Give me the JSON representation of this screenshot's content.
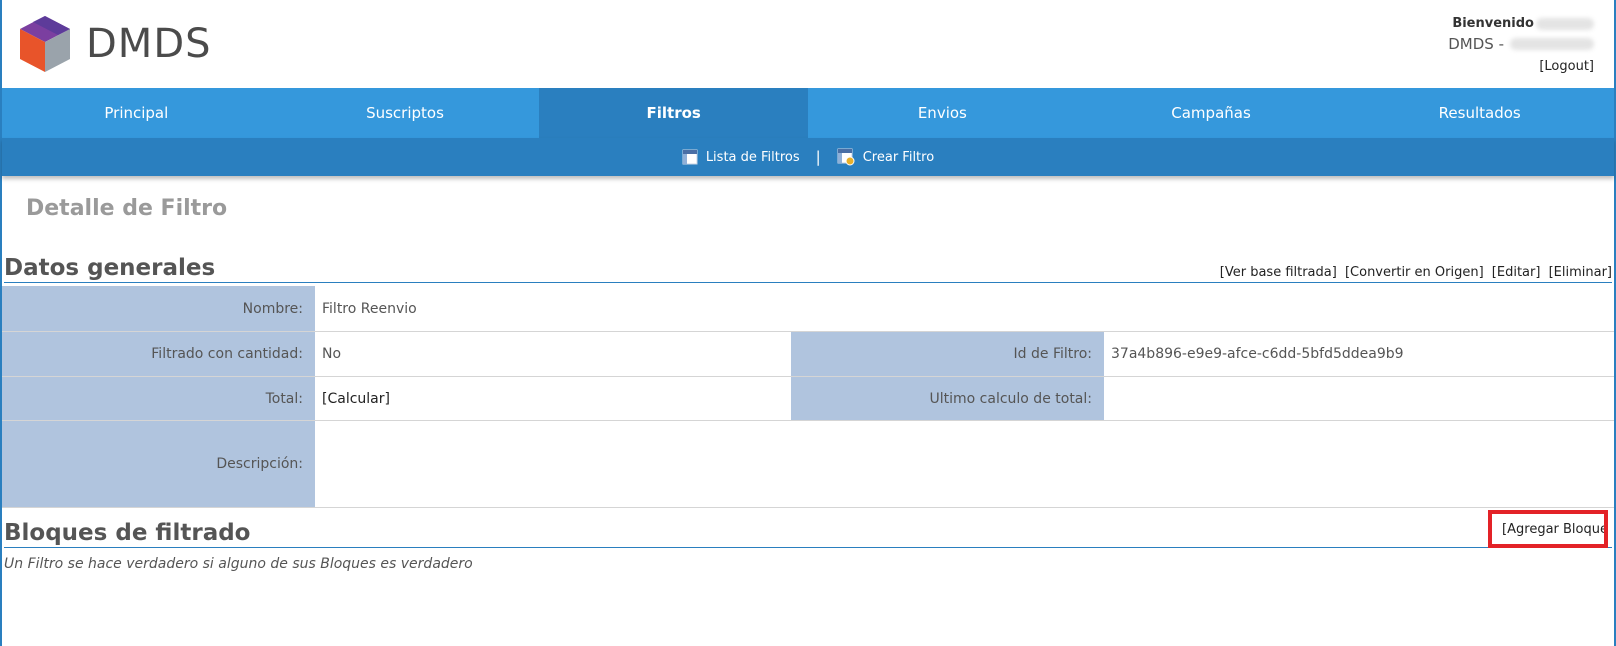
{
  "header": {
    "brand": "DMDS",
    "welcome_label": "Bienvenido",
    "dmds_prefix": "DMDS -",
    "logout": "[Logout]"
  },
  "nav": {
    "tabs": [
      {
        "label": "Principal"
      },
      {
        "label": "Suscriptos"
      },
      {
        "label": "Filtros",
        "active": true
      },
      {
        "label": "Envios"
      },
      {
        "label": "Campañas"
      },
      {
        "label": "Resultados"
      }
    ]
  },
  "subnav": {
    "items": [
      {
        "label": "Lista de Filtros",
        "icon": "list-icon"
      },
      {
        "label": "Crear Filtro",
        "icon": "add-filter-icon"
      }
    ],
    "separator": "|"
  },
  "page": {
    "title": "Detalle de Filtro"
  },
  "general": {
    "title": "Datos generales",
    "actions": [
      "[Ver base filtrada]",
      "[Convertir en Origen]",
      "[Editar]",
      "[Eliminar]"
    ],
    "fields": {
      "nombre_label": "Nombre:",
      "nombre_value": "Filtro Reenvio",
      "cantidad_label": "Filtrado con cantidad:",
      "cantidad_value": "No",
      "id_label": "Id de Filtro:",
      "id_value": "37a4b896-e9e9-afce-c6dd-5bfd5ddea9b9",
      "total_label": "Total:",
      "total_value": "[Calcular]",
      "ultimo_label": "Ultimo calculo de total:",
      "ultimo_value": "",
      "descripcion_label": "Descripción:",
      "descripcion_value": ""
    }
  },
  "blocks": {
    "title": "Bloques de filtrado",
    "add_label": "[Agregar Bloque",
    "note": "Un Filtro se hace verdadero si alguno de sus Bloques es verdadero"
  },
  "colors": {
    "nav": "#3598dc",
    "nav_active": "#2a7fbf",
    "label_bg": "#b0c4de",
    "highlight": "#e32227"
  }
}
